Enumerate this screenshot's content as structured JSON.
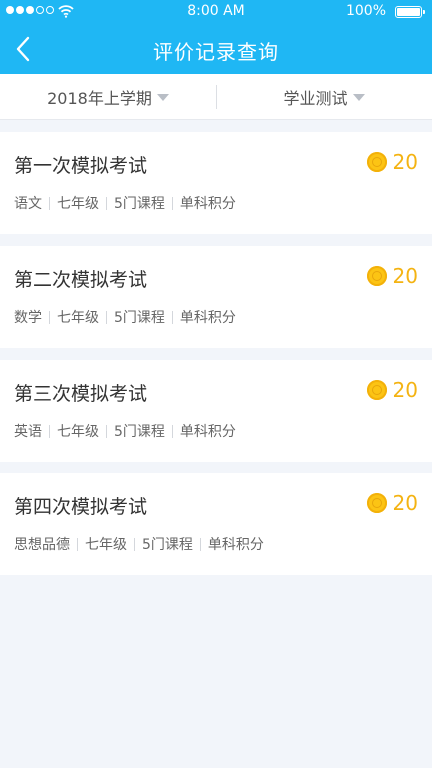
{
  "status_bar": {
    "time": "8:00 AM",
    "battery": "100%"
  },
  "header": {
    "title": "评价记录查询"
  },
  "filters": {
    "term": "2018年上学期",
    "category": "学业测试"
  },
  "records": [
    {
      "title": "第一次模拟考试",
      "score": "20",
      "tags": [
        "语文",
        "七年级",
        "5门课程",
        "单科积分"
      ]
    },
    {
      "title": "第二次模拟考试",
      "score": "20",
      "tags": [
        "数学",
        "七年级",
        "5门课程",
        "单科积分"
      ]
    },
    {
      "title": "第三次模拟考试",
      "score": "20",
      "tags": [
        "英语",
        "七年级",
        "5门课程",
        "单科积分"
      ]
    },
    {
      "title": "第四次模拟考试",
      "score": "20",
      "tags": [
        "思想品德",
        "七年级",
        "5门课程",
        "单科积分"
      ]
    }
  ],
  "colors": {
    "header": "#1fb7f4",
    "score": "#f4b312",
    "coin": "#fcc414"
  }
}
